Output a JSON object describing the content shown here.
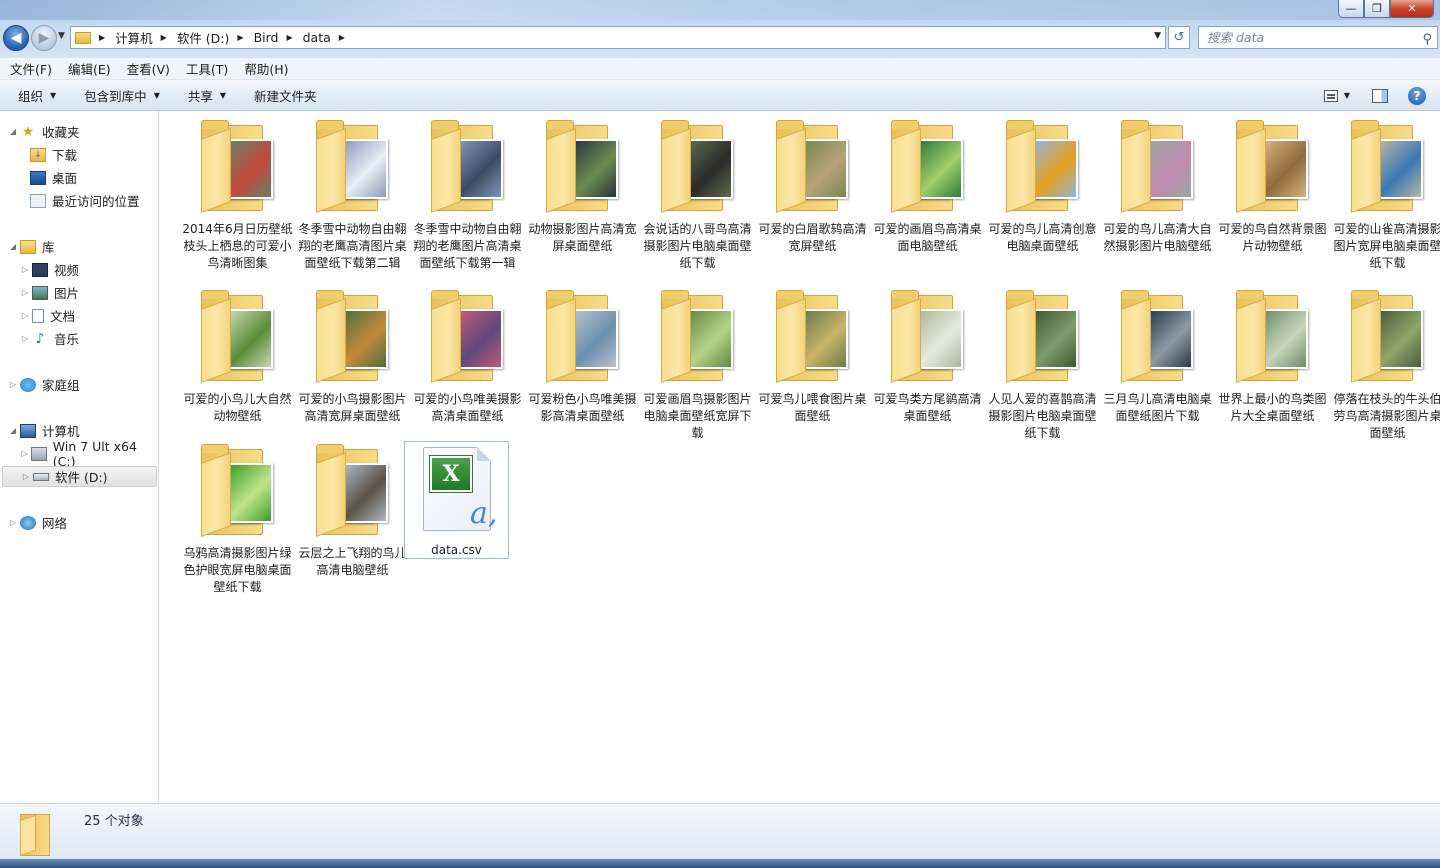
{
  "window": {
    "minimize_icon": "—",
    "maximize_icon": "❐",
    "close_icon": "✕"
  },
  "address": {
    "crumbs": [
      "计算机",
      "软件 (D:)",
      "Bird",
      "data"
    ],
    "search_placeholder": "搜索 data"
  },
  "menu": [
    "文件(F)",
    "编辑(E)",
    "查看(V)",
    "工具(T)",
    "帮助(H)"
  ],
  "toolbar": {
    "organize": "组织",
    "include_library": "包含到库中",
    "share": "共享",
    "new_folder": "新建文件夹"
  },
  "sidebar": {
    "favorites": "收藏夹",
    "downloads": "下载",
    "desktop": "桌面",
    "recent": "最近访问的位置",
    "libraries": "库",
    "videos": "视频",
    "pictures": "图片",
    "documents": "文档",
    "music": "音乐",
    "homegroup": "家庭组",
    "computer": "计算机",
    "drive_c": "Win 7 Ult x64 (C:)",
    "drive_d": "软件 (D:)",
    "network": "网络"
  },
  "items": [
    "2014年6月日历壁纸枝头上栖息的可爱小鸟清晰图集",
    "冬季雪中动物自由翱翔的老鹰高清图片桌面壁纸下载第二辑",
    "冬季雪中动物自由翱翔的老鹰图片高清桌面壁纸下载第一辑",
    "动物摄影图片高清宽屏桌面壁纸",
    "会说话的八哥鸟高清摄影图片电脑桌面壁纸下载",
    "可爱的白眉歌鸫高清宽屏壁纸",
    "可爱的画眉鸟高清桌面电脑壁纸",
    "可爱的鸟儿高清创意电脑桌面壁纸",
    "可爱的鸟儿高清大自然摄影图片电脑壁纸",
    "可爱的鸟自然背景图片动物壁纸",
    "可爱的山雀高清摄影图片宽屏电脑桌面壁纸下载",
    "可爱的小鸟儿大自然动物壁纸",
    "可爱的小鸟摄影图片高清宽屏桌面壁纸",
    "可爱的小鸟唯美摄影高清桌面壁纸",
    "可爱粉色小鸟唯美摄影高清桌面壁纸",
    "可爱画眉鸟摄影图片电脑桌面壁纸宽屏下载",
    "可爱鸟儿喂食图片桌面壁纸",
    "可爱鸟类方尾鹟高清桌面壁纸",
    "人见人爱的喜鹊高清摄影图片电脑桌面壁纸下载",
    "三月鸟儿高清电脑桌面壁纸图片下载",
    "世界上最小的鸟类图片大全桌面壁纸",
    "停落在枝头的牛头伯劳鸟高清摄影图片桌面壁纸",
    "乌鸦高清摄影图片绿色护眼宽屏电脑桌面壁纸下载",
    "云层之上飞翔的鸟儿高清电脑壁纸"
  ],
  "file": {
    "name": "data.csv",
    "icon": "excel-csv-icon"
  },
  "status": {
    "count": "25 个对象"
  }
}
